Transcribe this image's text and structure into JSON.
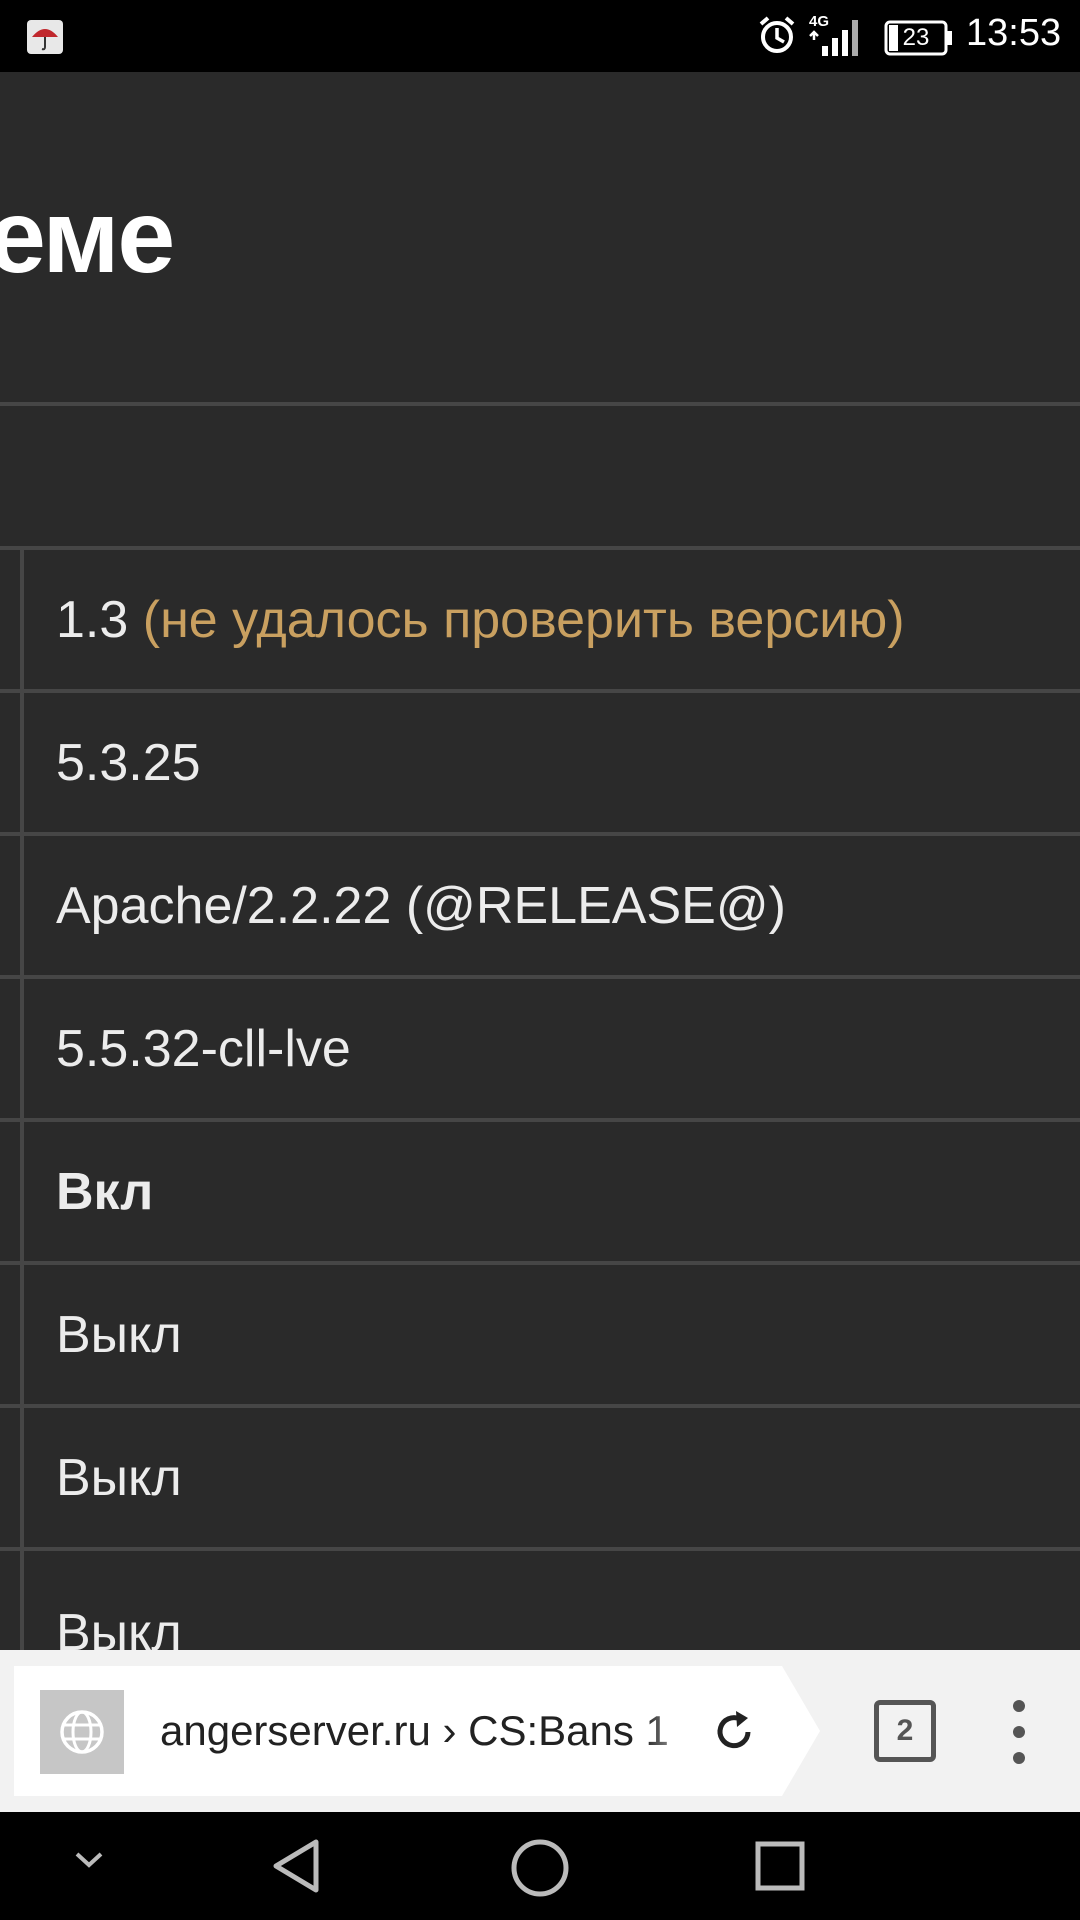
{
  "status_bar": {
    "time": "13:53",
    "battery": "23",
    "network": "4G",
    "icons": [
      "umbrella-app-icon",
      "alarm-icon",
      "signal-icon",
      "battery-icon"
    ]
  },
  "page": {
    "heading": "еме",
    "rows": [
      {
        "value": "1.3",
        "note": "(не удалось проверить версию)"
      },
      {
        "value": "5.3.25"
      },
      {
        "value": "Apache/2.2.22 (@RELEASE@)"
      },
      {
        "value": "5.5.32-cll-lve"
      },
      {
        "value": "Вкл"
      },
      {
        "value": "Выкл"
      },
      {
        "value": "Выкл"
      },
      {
        "value": "Выкл"
      }
    ],
    "colors": {
      "warning": "#c9a060",
      "on": "#c44a4a",
      "text": "#ececec",
      "background": "#2a2a2a"
    }
  },
  "browser": {
    "url": "angerserver.ru › CS:Bans 1",
    "tab_count": "2"
  },
  "nav_bar": {
    "icons": [
      "hide-keyboard-icon",
      "back-icon",
      "home-icon",
      "recents-icon"
    ]
  }
}
